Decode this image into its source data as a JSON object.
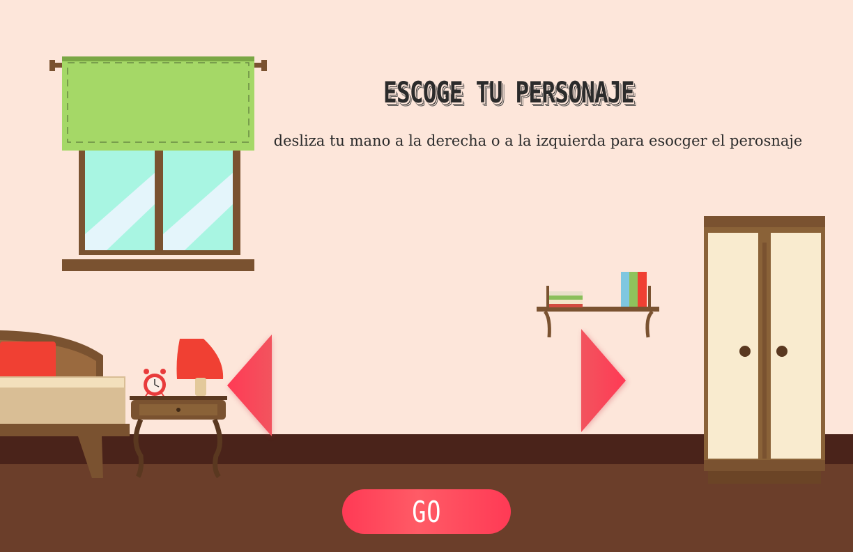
{
  "header": {
    "title": "ESCOGE TU PERSONAJE",
    "subtitle": "desliza tu mano a la derecha o a la izquierda para esocger el perosnaje"
  },
  "controls": {
    "go_label": "GO",
    "prev_icon": "triangle-left-icon",
    "next_icon": "triangle-right-icon"
  },
  "colors": {
    "wall": "#fde6da",
    "floor": "#6b3e2a",
    "baseboard": "#4a231a",
    "accent": "#ff3a55",
    "curtain": "#a5d867",
    "wood": "#7a5230"
  }
}
